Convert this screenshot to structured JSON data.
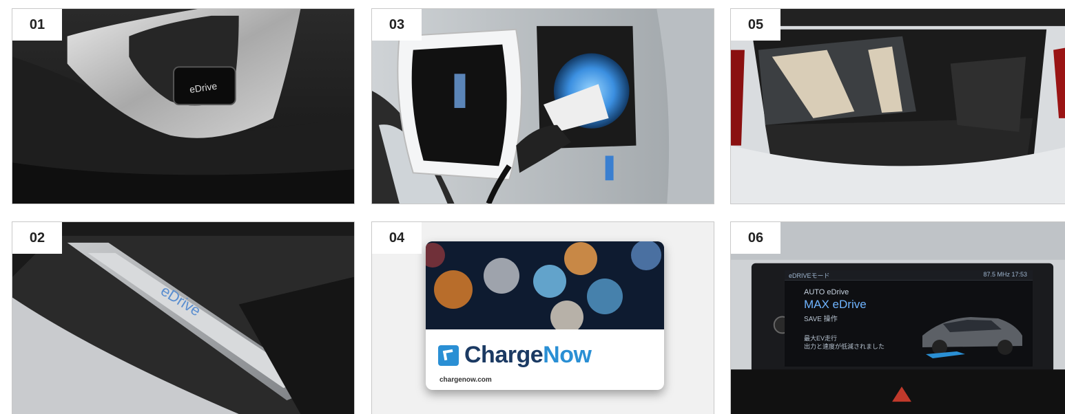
{
  "tiles": [
    {
      "number": "01",
      "emblem": "eDrive"
    },
    {
      "number": "03"
    },
    {
      "number": "05"
    },
    {
      "number": "02",
      "emblem": "eDrive"
    },
    {
      "number": "04",
      "card": {
        "brand_prefix": "Charge",
        "brand_suffix": "Now",
        "url": "chargenow.com"
      }
    },
    {
      "number": "06",
      "screen": {
        "mode_title": "eDRIVEモード",
        "radio": "87.5 MHz  17:53",
        "line1": "AUTO eDrive",
        "line2": "MAX eDrive",
        "line3": "SAVE 操作",
        "line4": "最大EV走行",
        "line5": "出力と速度が低減されました"
      }
    }
  ],
  "colors": {
    "accent": "#2a8fd4",
    "brand_dark": "#1b3a63"
  }
}
